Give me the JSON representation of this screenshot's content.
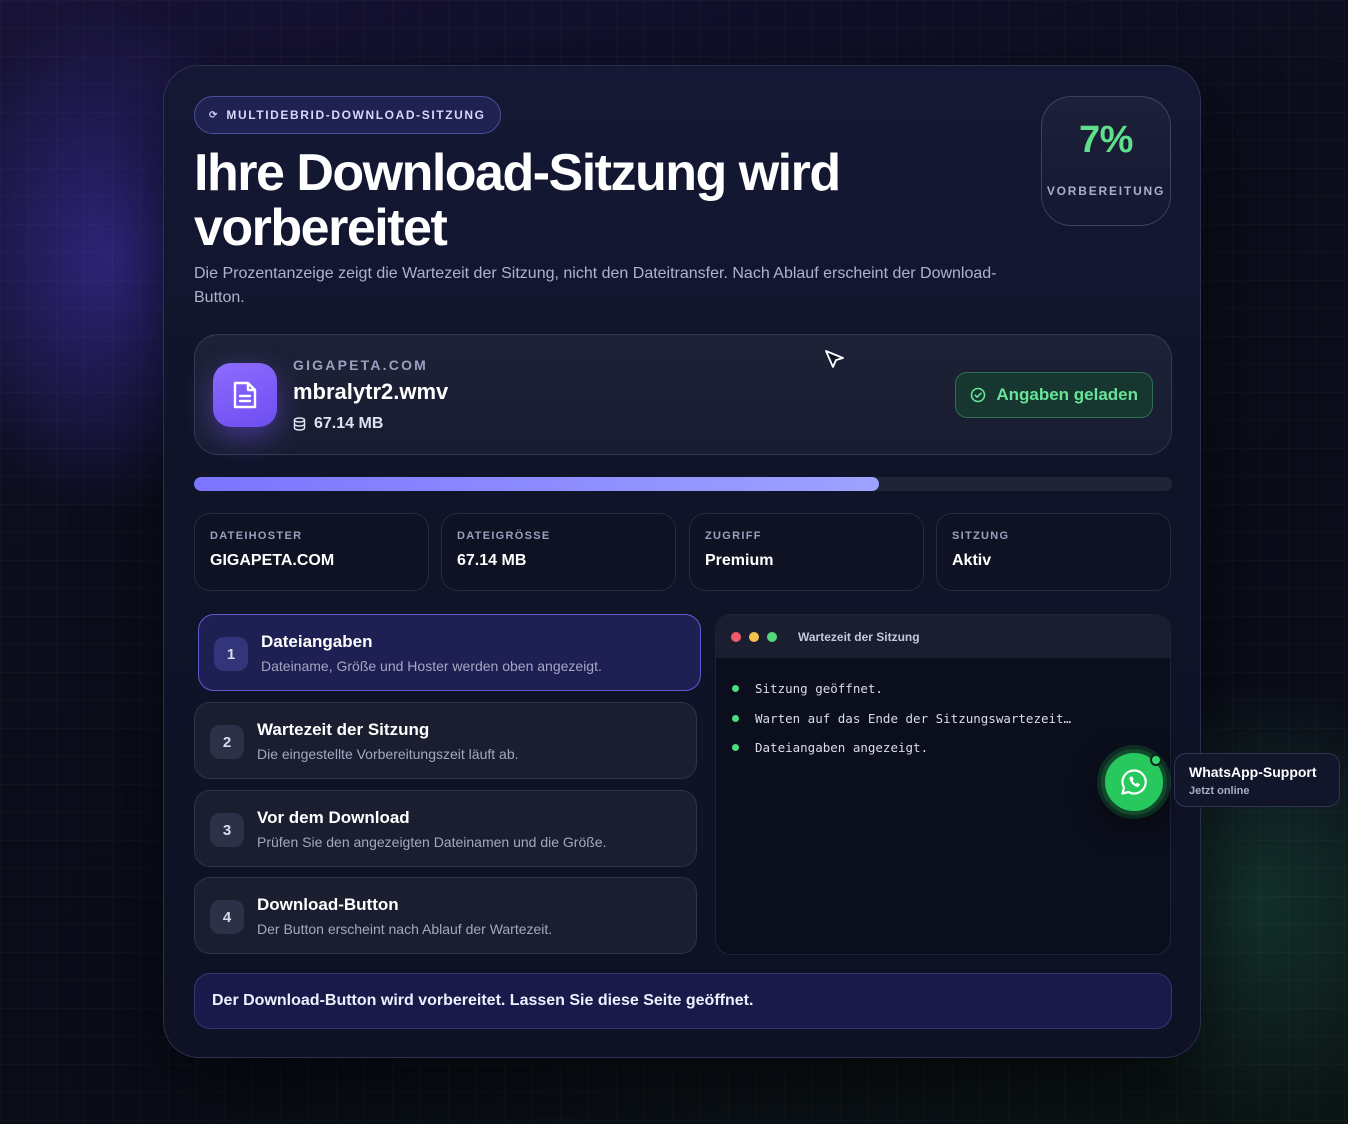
{
  "header": {
    "badge_icon": "⟳",
    "badge": "MULTIDEBRID-DOWNLOAD-SITZUNG",
    "title": "Ihre Download-Sitzung wird vorbereitet",
    "subtitle": "Die Prozentanzeige zeigt die Wartezeit der Sitzung, nicht den Dateitransfer. Nach Ablauf erscheint der Download-Button."
  },
  "progress_box": {
    "value": "7%",
    "label": "VORBEREITUNG",
    "fraction": 0.07
  },
  "file": {
    "host": "GIGAPETA.COM",
    "name": "mbralytr2.wmv",
    "size": "67.14 MB",
    "icon": "document-icon",
    "status": "Angaben geladen"
  },
  "stats": [
    {
      "label": "DATEIHOSTER",
      "value": "GIGAPETA.COM"
    },
    {
      "label": "DATEIGRÖSSE",
      "value": "67.14 MB"
    },
    {
      "label": "ZUGRIFF",
      "value": "Premium"
    },
    {
      "label": "SITZUNG",
      "value": "Aktiv"
    }
  ],
  "steps": [
    {
      "num": "1",
      "title": "Dateiangaben",
      "desc": "Dateiname, Größe und Hoster werden oben angezeigt."
    },
    {
      "num": "2",
      "title": "Wartezeit der Sitzung",
      "desc": "Die eingestellte Vorbereitungszeit läuft ab."
    },
    {
      "num": "3",
      "title": "Vor dem Download",
      "desc": "Prüfen Sie den angezeigten Dateinamen und die Größe."
    },
    {
      "num": "4",
      "title": "Download-Button",
      "desc": "Der Button erscheint nach Ablauf der Wartezeit."
    }
  ],
  "terminal": {
    "title": "Wartezeit der Sitzung",
    "lines": [
      "Sitzung geöffnet.",
      "Warten auf das Ende der Sitzungswartezeit…",
      "Dateiangaben angezeigt."
    ]
  },
  "footer": "Der Download-Button wird vorbereitet. Lassen Sie diese Seite geöffnet.",
  "whatsapp": {
    "title": "WhatsApp-Support",
    "status": "Jetzt online"
  },
  "colors": {
    "accent": "#7b74ff",
    "success": "#5ee08a",
    "whatsapp": "#27c95f"
  }
}
